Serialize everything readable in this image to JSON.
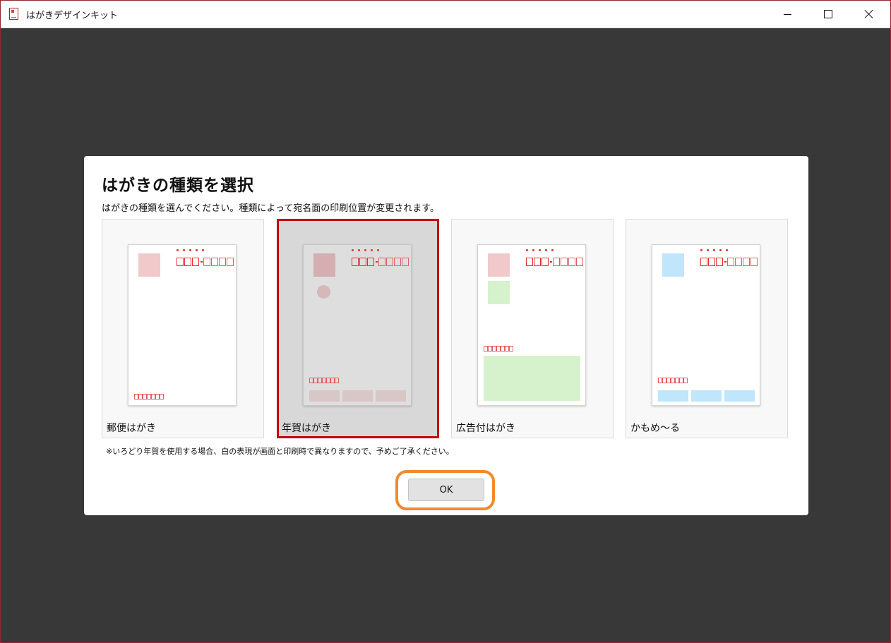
{
  "window": {
    "title": "はがきデザインキット"
  },
  "dialog": {
    "title": "はがきの種類を選択",
    "subtitle": "はがきの種類を選んでください。種類によって宛名面の印刷位置が変更されます。",
    "note": "※いろどり年賀を使用する場合、白の表現が画面と印刷時で異なりますので、予めご了承ください。",
    "ok_label": "OK",
    "cards": [
      {
        "label": "郵便はがき",
        "selected": false,
        "stamp_color": "#f1c9cb"
      },
      {
        "label": "年賀はがき",
        "selected": true,
        "stamp_color": "#d4aeb0"
      },
      {
        "label": "広告付はがき",
        "selected": false,
        "stamp_color": "#f1c9cb"
      },
      {
        "label": "かもめ～る",
        "selected": false,
        "stamp_color": "#bfe6fa"
      }
    ]
  },
  "colors": {
    "accent_red": "#c40000",
    "highlight_orange": "#f08a2c",
    "background": "#383838"
  }
}
